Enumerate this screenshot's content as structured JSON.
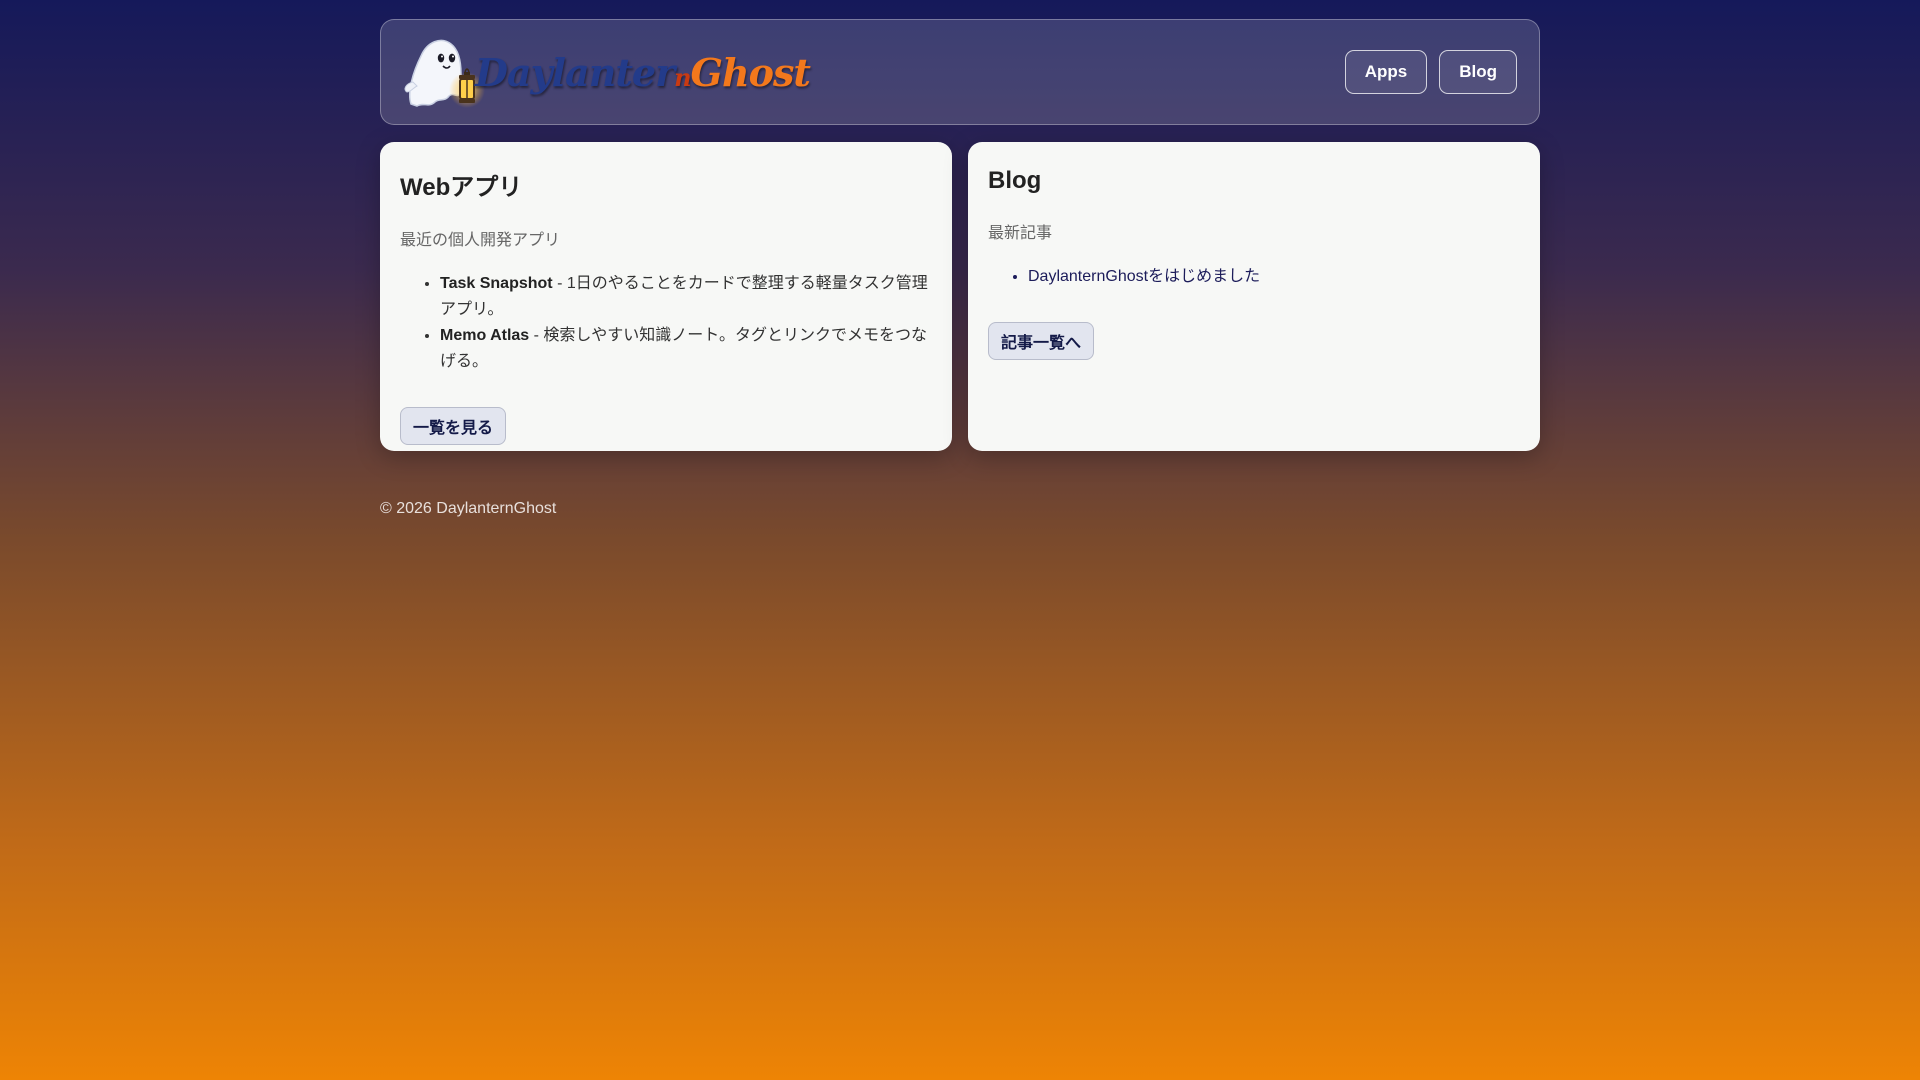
{
  "header": {
    "logo_text_1": "Daylanter",
    "logo_text_2": "n",
    "logo_text_3": "Ghost",
    "nav": [
      {
        "label": "Apps"
      },
      {
        "label": "Blog"
      }
    ]
  },
  "apps_card": {
    "title": "Webアプリ",
    "subtitle": "最近の個人開発アプリ",
    "items": [
      {
        "name": "Task Snapshot",
        "desc": " - 1日のやることをカードで整理する軽量タスク管理アプリ。"
      },
      {
        "name": "Memo Atlas",
        "desc": " - 検索しやすい知識ノート。タグとリンクでメモをつなげる。"
      }
    ],
    "button_label": "一覧を見る"
  },
  "blog_card": {
    "title": "Blog",
    "subtitle": "最新記事",
    "items": [
      {
        "title": "DaylanternGhostをはじめました"
      }
    ],
    "button_label": "記事一覧へ"
  },
  "footer": {
    "copyright": "© 2026 DaylanternGhost"
  },
  "colors": {
    "bg_top": "#15195a",
    "bg_bottom": "#ee8404",
    "card_bg": "#f7f8f6",
    "button_bg": "#e2e5ef"
  },
  "icons": [
    "ghost-icon",
    "lantern-icon"
  ]
}
